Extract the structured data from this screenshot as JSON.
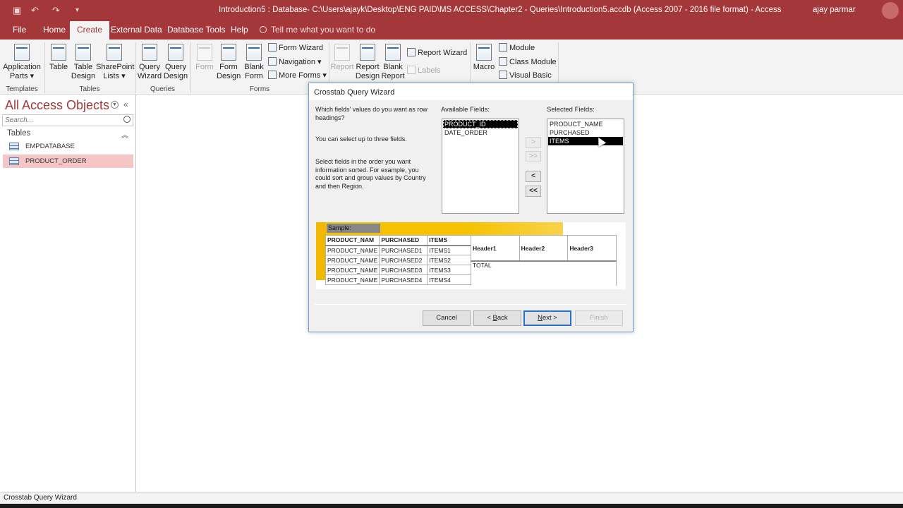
{
  "window": {
    "title": "Introduction5 : Database- C:\\Users\\ajayk\\Desktop\\ENG PAID\\MS ACCESS\\Chapter2 - Queries\\Introduction5.accdb (Access 2007 - 2016 file format)  -  Access",
    "user": "ajay parmar"
  },
  "tabs": [
    "File",
    "Home",
    "Create",
    "External Data",
    "Database Tools",
    "Help"
  ],
  "active_tab": "Create",
  "tellme": "Tell me what you want to do",
  "ribbon": {
    "templates": {
      "label": "Templates",
      "app_parts_1": "Application",
      "app_parts_2": "Parts ▾"
    },
    "tables": {
      "label": "Tables",
      "table": "Table",
      "table_design_1": "Table",
      "table_design_2": "Design",
      "sharepoint_1": "SharePoint",
      "sharepoint_2": "Lists ▾"
    },
    "queries": {
      "label": "Queries",
      "wizard_1": "Query",
      "wizard_2": "Wizard",
      "design_1": "Query",
      "design_2": "Design"
    },
    "forms": {
      "label": "Forms",
      "form": "Form",
      "form_design_1": "Form",
      "form_design_2": "Design",
      "blank_form_1": "Blank",
      "blank_form_2": "Form",
      "form_wizard": "Form Wizard",
      "navigation": "Navigation ▾",
      "more_forms": "More Forms ▾"
    },
    "reports": {
      "report": "Report",
      "report_design_1": "Report",
      "report_design_2": "Design",
      "blank_report_1": "Blank",
      "blank_report_2": "Report",
      "report_wizard": "Report Wizard",
      "labels": "Labels"
    },
    "macros": {
      "macro": "Macro",
      "module": "Module",
      "class_module": "Class Module",
      "visual_basic": "Visual Basic"
    }
  },
  "nav": {
    "heading": "All Access Objects",
    "search_placeholder": "Search...",
    "section": "Tables",
    "items": [
      "EMPDATABASE",
      "PRODUCT_ORDER"
    ]
  },
  "status": "Crosstab Query Wizard",
  "dialog": {
    "title": "Crosstab Query Wizard",
    "q1": "Which fields' values do you want as row",
    "q2": "headings?",
    "limit": "You can select up to three fields.",
    "hint1": "Select fields in the order you want",
    "hint2": "information sorted.  For example, you",
    "hint3": "could sort and group values by Country",
    "hint4": "and then Region.",
    "available_label": "Available Fields:",
    "selected_label": "Selected Fields:",
    "available": [
      "PRODUCT_ID",
      "DATE_ORDER"
    ],
    "selected": [
      "PRODUCT_NAME",
      "PURCHASED",
      "ITEMS"
    ],
    "move": {
      "one": ">",
      "all": ">>",
      "back_one": "<",
      "back_all": "<<"
    },
    "sample_label": "Sample:",
    "sample_headers": [
      "PRODUCT_NAM",
      "PURCHASED",
      "ITEMS"
    ],
    "sample_rows": [
      [
        "PRODUCT_NAME",
        "PURCHASED1",
        "ITEMS1"
      ],
      [
        "PRODUCT_NAME",
        "PURCHASED2",
        "ITEMS2"
      ],
      [
        "PRODUCT_NAME",
        "PURCHASED3",
        "ITEMS3"
      ],
      [
        "PRODUCT_NAME",
        "PURCHASED4",
        "ITEMS4"
      ]
    ],
    "col_headers": [
      "Header1",
      "Header2",
      "Header3"
    ],
    "total": "TOTAL",
    "buttons": {
      "cancel": "Cancel",
      "back_pre": "< ",
      "back_key": "B",
      "back_post": "ack",
      "next_key": "N",
      "next_post": "ext >",
      "finish": "Finish"
    }
  }
}
